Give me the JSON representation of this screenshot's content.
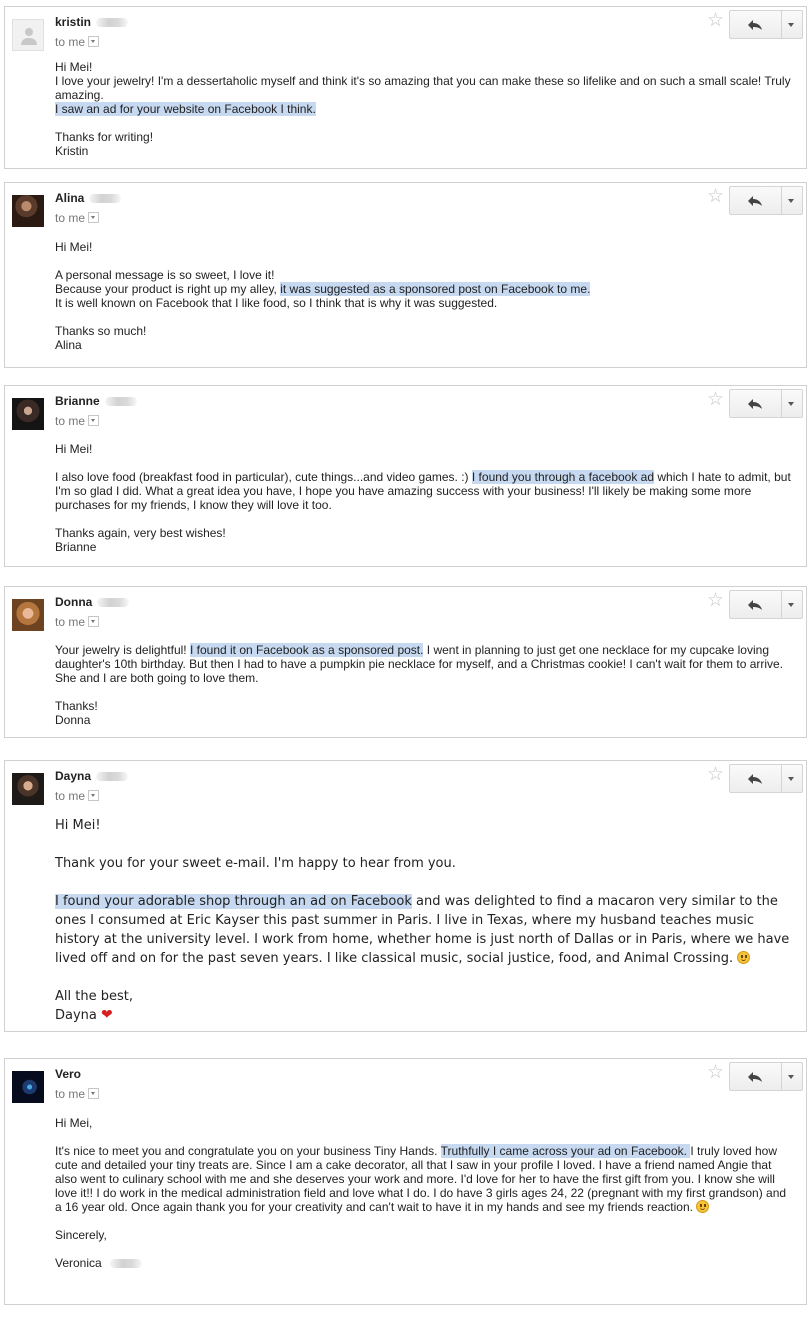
{
  "recipient_label": "to me",
  "emails": [
    {
      "sender_first": "kristin",
      "avatar": "default-avatar",
      "paragraphs": [
        [
          {
            "t": "Hi Mei!"
          }
        ],
        [
          {
            "t": "I love your jewelry!  I'm a  dessertaholic myself and think it's so amazing that you can make these so lifelike and on such a small scale!  Truly amazing."
          }
        ],
        [
          {
            "t": " I saw an ad for your website on Facebook I think. ",
            "hl": true
          }
        ],
        [
          {
            "t": ""
          }
        ],
        [
          {
            "t": "Thanks for writing!"
          }
        ],
        [
          {
            "t": "Kristin"
          }
        ]
      ]
    },
    {
      "sender_first": "Alina",
      "avatar": "photo-avatar",
      "paragraphs": [
        [
          {
            "t": "Hi Mei!"
          }
        ],
        [
          {
            "t": ""
          }
        ],
        [
          {
            "t": "A personal message is so sweet, I love it!"
          }
        ],
        [
          {
            "t": "Because your product is right up my alley, "
          },
          {
            "t": "it was suggested as a sponsored post on Facebook to me. ",
            "hl": true
          }
        ],
        [
          {
            "t": "It is well known on Facebook that I like food, so I think that is why it was suggested."
          }
        ],
        [
          {
            "t": ""
          }
        ],
        [
          {
            "t": "Thanks so much!"
          }
        ],
        [
          {
            "t": "Alina"
          }
        ]
      ]
    },
    {
      "sender_first": "Brianne",
      "avatar": "photo-avatar",
      "paragraphs": [
        [
          {
            "t": "Hi Mei!"
          }
        ],
        [
          {
            "t": ""
          }
        ],
        [
          {
            "t": "I also love food (breakfast food in particular), cute things...and video games. :) "
          },
          {
            "t": "I found you through a facebook ad",
            "hl": true
          },
          {
            "t": " which I hate to admit, but I'm so glad I did. What a great idea you have, I hope you have amazing success with your business!  I'll likely be making some more purchases for my friends, I know they will love it too."
          }
        ],
        [
          {
            "t": ""
          }
        ],
        [
          {
            "t": "Thanks again, very best wishes!"
          }
        ],
        [
          {
            "t": "Brianne"
          }
        ]
      ]
    },
    {
      "sender_first": "Donna",
      "avatar": "photo-avatar",
      "paragraphs": [
        [
          {
            "t": "Your jewelry is delightful! "
          },
          {
            "t": "I found it on Facebook as a sponsored post.",
            "hl": true
          },
          {
            "t": " I went in planning to just get one necklace for my cupcake loving daughter's 10th birthday. But then I had to have a pumpkin pie necklace for myself, and a Christmas cookie! I can't wait for them to arrive. She and I are both going to love them."
          }
        ],
        [
          {
            "t": ""
          }
        ],
        [
          {
            "t": "Thanks!"
          }
        ],
        [
          {
            "t": "Donna"
          }
        ]
      ]
    },
    {
      "sender_first": "Dayna",
      "avatar": "photo-avatar",
      "paragraphs": [
        [
          {
            "t": "Hi Mei!"
          }
        ],
        [
          {
            "t": ""
          }
        ],
        [
          {
            "t": "Thank you for  your sweet e-mail. I'm happy to hear from you."
          }
        ],
        [
          {
            "t": ""
          }
        ],
        [
          {
            "t": "I found your adorable shop through an ad on Facebook",
            "hl": true
          },
          {
            "t": " and was delighted to find a macaron very similar to the ones I consumed at Eric Kayser this past summer in Paris. I live in Texas, where my husband teaches music history at the university level. I work from home, whether home is just north of Dallas or in Paris, where we have lived off and on for the past seven years. I like classical music, social justice, food, and Animal Crossing. "
          },
          {
            "icon": "smiley"
          }
        ],
        [
          {
            "t": ""
          }
        ],
        [
          {
            "t": "All the best,"
          }
        ],
        [
          {
            "t": "Dayna "
          },
          {
            "icon": "heart"
          }
        ]
      ]
    },
    {
      "sender_first": "Vero",
      "avatar": "photo-avatar",
      "paragraphs": [
        [
          {
            "t": "Hi Mei,"
          }
        ],
        [
          {
            "t": ""
          }
        ],
        [
          {
            "t": "It's nice to meet you and congratulate you on your business Tiny Hands. "
          },
          {
            "t": " Truthfully I came across your ad on Facebook. ",
            "hl": true
          },
          {
            "t": " I truly loved how cute and detailed your tiny treats are.  Since I am a cake decorator, all that I saw in your profile I loved. I have a friend named Angie that also went to culinary school with me and she deserves your work and more. I'd love for her to have the first gift from you.  I know she will love it!! I do work in the medical administration field and love what I do. I do have 3 girls ages 24, 22 (pregnant with my first grandson) and a 16 year old.  Once again thank you for your creativity and can't wait to have it in my hands and see my friends reaction. "
          },
          {
            "icon": "smiley"
          }
        ],
        [
          {
            "t": ""
          }
        ],
        [
          {
            "t": "Sincerely,"
          }
        ],
        [
          {
            "t": ""
          }
        ],
        [
          {
            "t": "Veronica "
          },
          {
            "icon": "blur"
          }
        ]
      ]
    }
  ]
}
